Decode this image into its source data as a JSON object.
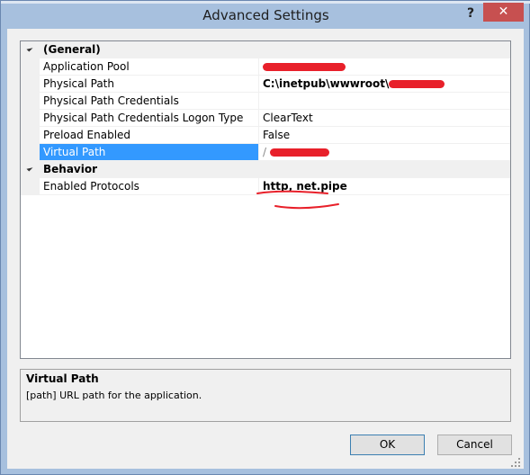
{
  "window": {
    "title": "Advanced Settings",
    "help_glyph": "?",
    "close_glyph": "✕"
  },
  "grid": {
    "categories": [
      {
        "label": "(General)",
        "properties": [
          {
            "name": "Application Pool",
            "value": "",
            "redacted": true
          },
          {
            "name": "Physical Path",
            "value": "C:\\inetpub\\wwwroot\\",
            "redacted": true
          },
          {
            "name": "Physical Path Credentials",
            "value": ""
          },
          {
            "name": "Physical Path Credentials Logon Type",
            "value": "ClearText"
          },
          {
            "name": "Preload Enabled",
            "value": "False"
          },
          {
            "name": "Virtual Path",
            "value": "/",
            "redacted": true,
            "selected": true
          }
        ]
      },
      {
        "label": "Behavior",
        "properties": [
          {
            "name": "Enabled Protocols",
            "value": "http, net.pipe"
          }
        ]
      }
    ]
  },
  "description": {
    "title": "Virtual Path",
    "text": "[path] URL path for the application."
  },
  "buttons": {
    "ok": "OK",
    "cancel": "Cancel"
  },
  "colors": {
    "selection": "#3399ff",
    "annotation": "#e8202a"
  }
}
